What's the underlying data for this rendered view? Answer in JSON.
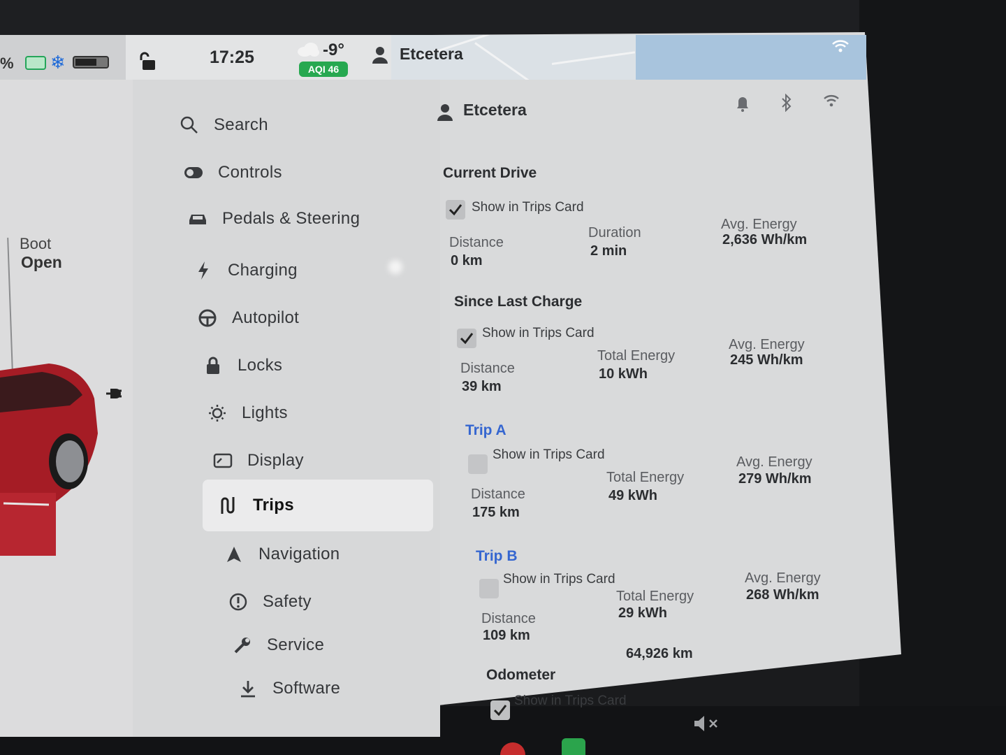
{
  "status_bar": {
    "battery_percent": "%",
    "time": "17:25",
    "temperature": "-9°",
    "aqi": "AQI 46",
    "profile": "Etcetera"
  },
  "car": {
    "boot_label": "Boot",
    "boot_state": "Open"
  },
  "sidebar": {
    "items": [
      {
        "label": "Search",
        "icon": "search-icon"
      },
      {
        "label": "Controls",
        "icon": "toggle-icon"
      },
      {
        "label": "Pedals & Steering",
        "icon": "car-icon"
      },
      {
        "label": "Charging",
        "icon": "bolt-icon"
      },
      {
        "label": "Autopilot",
        "icon": "steering-wheel-icon"
      },
      {
        "label": "Locks",
        "icon": "lock-icon"
      },
      {
        "label": "Lights",
        "icon": "light-icon"
      },
      {
        "label": "Display",
        "icon": "display-icon"
      },
      {
        "label": "Trips",
        "icon": "trips-icon",
        "selected": true
      },
      {
        "label": "Navigation",
        "icon": "navigation-icon"
      },
      {
        "label": "Safety",
        "icon": "safety-icon"
      },
      {
        "label": "Service",
        "icon": "wrench-icon"
      },
      {
        "label": "Software",
        "icon": "download-icon"
      }
    ]
  },
  "header": {
    "profile_name": "Etcetera"
  },
  "trips": {
    "current_drive": {
      "title": "Current Drive",
      "show_label": "Show in Trips Card",
      "checked": true,
      "distance_label": "Distance",
      "distance": "0 km",
      "duration_label": "Duration",
      "duration": "2 min",
      "avg_label": "Avg. Energy",
      "avg": "2,636 Wh/km"
    },
    "since_last_charge": {
      "title": "Since Last Charge",
      "show_label": "Show in Trips Card",
      "checked": true,
      "distance_label": "Distance",
      "distance": "39 km",
      "energy_label": "Total Energy",
      "energy": "10 kWh",
      "avg_label": "Avg. Energy",
      "avg": "245 Wh/km"
    },
    "trip_a": {
      "title": "Trip A",
      "show_label": "Show in Trips Card",
      "checked": false,
      "distance_label": "Distance",
      "distance": "175 km",
      "energy_label": "Total Energy",
      "energy": "49 kWh",
      "avg_label": "Avg. Energy",
      "avg": "279 Wh/km"
    },
    "trip_b": {
      "title": "Trip B",
      "show_label": "Show in Trips Card",
      "checked": false,
      "distance_label": "Distance",
      "distance": "109 km",
      "energy_label": "Total Energy",
      "energy": "29 kWh",
      "avg_label": "Avg. Energy",
      "avg": "268 Wh/km"
    },
    "odometer": {
      "title": "Odometer",
      "value": "64,926 km",
      "show_label": "Show in Trips Card",
      "checked": true
    }
  },
  "colors": {
    "accent_blue": "#3566d0",
    "aqi_green": "#27a850",
    "snow_blue": "#1d69d8",
    "car_red": "#b3202a"
  }
}
